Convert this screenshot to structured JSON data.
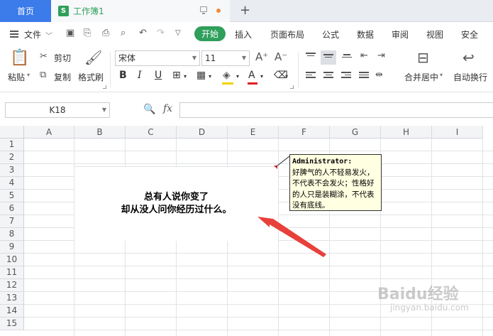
{
  "tabbar": {
    "home_label": "首页",
    "doc_icon": "S",
    "doc_title": "工作簿1",
    "add_icon": "+"
  },
  "menu": {
    "file_label": "文件",
    "start_label": "开始",
    "items": [
      "插入",
      "页面布局",
      "公式",
      "数据",
      "审阅",
      "视图",
      "安全"
    ]
  },
  "ribbon": {
    "paste_label": "粘贴",
    "cut_label": "剪切",
    "copy_label": "复制",
    "format_painter_label": "格式刷",
    "font_name": "宋体",
    "font_size": "11",
    "bold": "B",
    "italic": "I",
    "underline": "U",
    "merge_center_label": "合并居中",
    "wrap_text_label": "自动换行"
  },
  "formula_bar": {
    "cell_ref": "K18",
    "fx_label": "fx",
    "value": ""
  },
  "sheet": {
    "columns": [
      "A",
      "B",
      "C",
      "D",
      "E",
      "F",
      "G",
      "H",
      "I"
    ],
    "rows": [
      "1",
      "2",
      "3",
      "4",
      "5",
      "6",
      "7",
      "8",
      "9",
      "10",
      "11",
      "12",
      "13",
      "14",
      "15"
    ],
    "merged_text_line1": "总有人说你变了",
    "merged_text_line2": "却从没人问你经历过什么。"
  },
  "comment": {
    "author": "Administrator:",
    "body": "好脾气的人不轻易发火，不代表不会发火；性格好的人只是装糊涂，不代表没有底线。"
  },
  "watermark": {
    "text": "Baidu经验",
    "sub": "jingyan.baidu.com"
  },
  "colors": {
    "accent_blue": "#3b7bea",
    "accent_green": "#2f9f5b",
    "comment_bg": "#ffffe1",
    "arrow_red": "#e8403a"
  }
}
